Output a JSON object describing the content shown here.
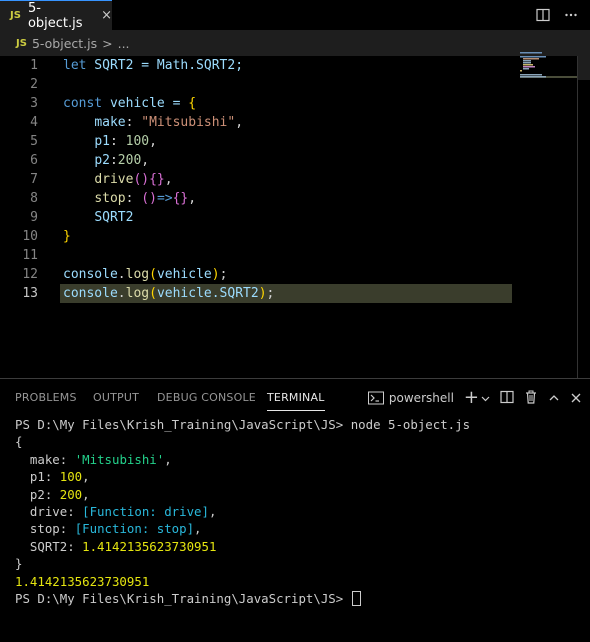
{
  "tab": {
    "badge": "JS",
    "label": "5-object.js",
    "close": "×"
  },
  "breadcrumb": {
    "badge": "JS",
    "file": "5-object.js",
    "sep": ">",
    "more": "..."
  },
  "editor": {
    "line_numbers": [
      "1",
      "2",
      "3",
      "4",
      "5",
      "6",
      "7",
      "8",
      "9",
      "10",
      "11",
      "12",
      "13"
    ],
    "line1": {
      "kw": "let",
      "rest": " SQRT2 = Math.SQRT2;"
    },
    "line3": {
      "kw": "const",
      "rest": " vehicle = ",
      "brace": "{"
    },
    "line4": {
      "prop": "make",
      "colon": ": ",
      "str": "\"Mitsubishi\"",
      "comma": ","
    },
    "line5": {
      "prop": "p1",
      "colon": ": ",
      "num": "100",
      "comma": ","
    },
    "line6": {
      "prop": "p2",
      "colon": ":",
      "num": "200",
      "comma": ","
    },
    "line7": {
      "fn": "drive",
      "paren": "()",
      "braces": "{}",
      "comma": ","
    },
    "line8": {
      "prop": "stop",
      "colon": ": ",
      "paren": "()",
      "arrow": "=>",
      "braces": "{}",
      "comma": ","
    },
    "line9": {
      "prop": "SQRT2"
    },
    "line10": {
      "brace": "}"
    },
    "line12": {
      "obj": "console",
      "dot": ".",
      "fn": "log",
      "open": "(",
      "arg": "vehicle",
      "close": ")",
      "semi": ";"
    },
    "line13": {
      "obj": "console",
      "dot": ".",
      "fn": "log",
      "open": "(",
      "arg": "vehicle.SQRT2",
      "close": ")",
      "semi": ";"
    }
  },
  "panel": {
    "tabs": [
      "PROBLEMS",
      "OUTPUT",
      "DEBUG CONSOLE",
      "TERMINAL"
    ],
    "active_tab": "TERMINAL",
    "shell": "powershell",
    "add": "+"
  },
  "terminal": {
    "prompt": "PS D:\\My Files\\Krish_Training\\JavaScript\\JS>",
    "command": " node 5-object.js",
    "open": "{",
    "make_key": "  make: ",
    "make_val": "'Mitsubishi'",
    "make_comma": ",",
    "p1_key": "  p1: ",
    "p1_val": "100",
    "p1_comma": ",",
    "p2_key": "  p2: ",
    "p2_val": "200",
    "p2_comma": ",",
    "drive_key": "  drive: ",
    "drive_val": "[Function: drive]",
    "drive_comma": ",",
    "stop_key": "  stop: ",
    "stop_val": "[Function: stop]",
    "stop_comma": ",",
    "sqrt_key": "  SQRT2: ",
    "sqrt_val": "1.4142135623730951",
    "close": "}",
    "result": "1.4142135623730951",
    "prompt2": "PS D:\\My Files\\Krish_Training\\JavaScript\\JS> "
  },
  "colors": {
    "accent": "#3794ff",
    "current_line": "#3a3d2c",
    "js_badge": "#cbcb41"
  }
}
